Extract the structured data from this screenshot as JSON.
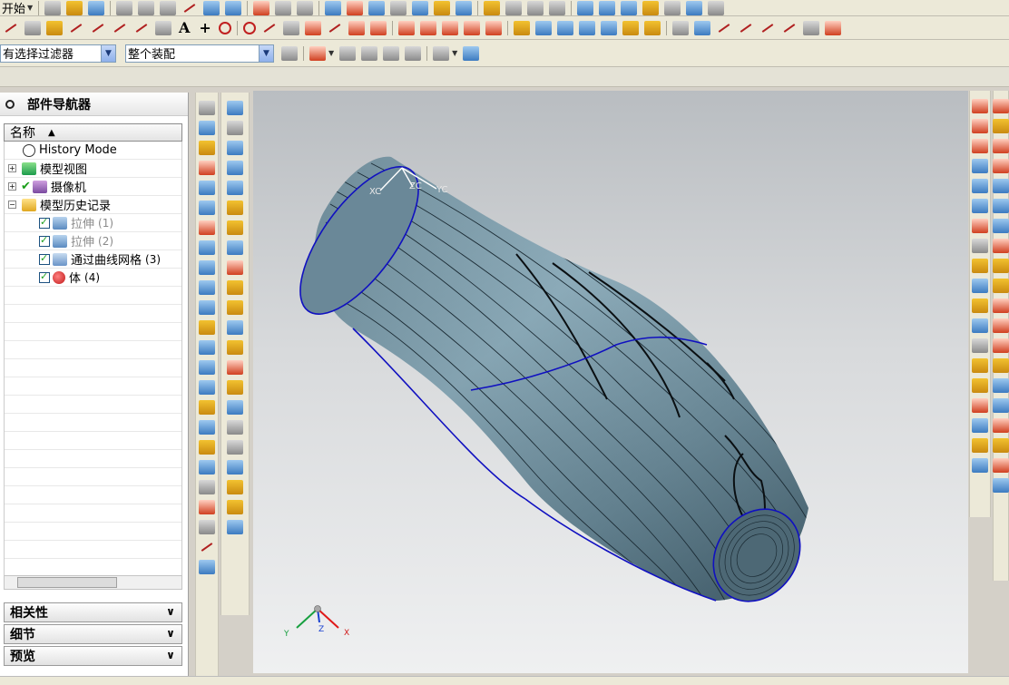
{
  "toolbar": {
    "start_menu": "开始",
    "filter_select": "有选择过滤器",
    "assembly_select": "整个装配"
  },
  "navigator": {
    "title": "部件导航器",
    "column_header": "名称",
    "tree": [
      {
        "label": "History Mode"
      },
      {
        "label": "模型视图"
      },
      {
        "label": "摄像机"
      },
      {
        "label": "模型历史记录"
      },
      {
        "label": "拉伸",
        "id_suffix": "(1)"
      },
      {
        "label": "拉伸",
        "id_suffix": "(2)"
      },
      {
        "label": "通过曲线网格",
        "id_suffix": "(3)"
      },
      {
        "label": "体",
        "id_suffix": "(4)"
      }
    ],
    "sections": [
      "相关性",
      "细节",
      "预览"
    ]
  },
  "viewport": {
    "wcs_axes": [
      "XC",
      "YC",
      "ZC"
    ],
    "view_triad": [
      "X",
      "Y",
      "Z"
    ],
    "colors": {
      "body": "#6b8797",
      "edge": "#1010c0",
      "background_top": "#b9bdc1",
      "background_bottom": "#eff0f1"
    }
  },
  "icons": [
    "new-icon",
    "open-icon",
    "save-icon",
    "cut-icon",
    "copy-icon",
    "paste-icon",
    "delete-icon",
    "undo-icon",
    "redo-icon",
    "text-icon",
    "point-icon",
    "circle-icon",
    "arc-icon",
    "spline-icon",
    "rotate-icon",
    "zoom-icon",
    "pan-icon",
    "fit-icon",
    "shaded-view-icon",
    "wireframe-icon",
    "extrude-icon",
    "revolve-icon",
    "hole-icon",
    "block-icon",
    "cylinder-icon",
    "sphere-icon",
    "blend-icon",
    "chamfer-icon",
    "mesh-surface-icon",
    "sweep-icon",
    "trim-icon",
    "measure-icon",
    "layer-icon"
  ]
}
